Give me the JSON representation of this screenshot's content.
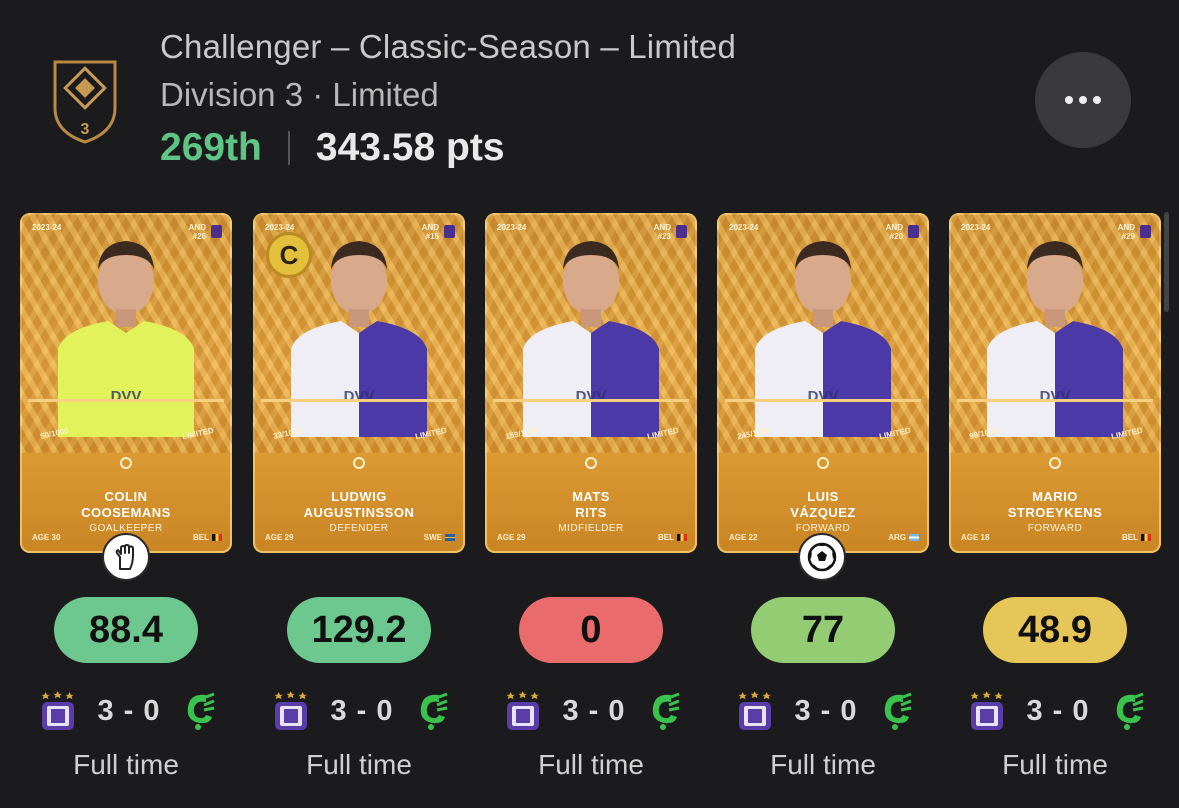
{
  "header": {
    "title": "Challenger – Classic-Season – Limited",
    "subtitle": "Division 3 · Limited",
    "rank": "269th",
    "points": "343.58 pts",
    "division_badge_number": "3",
    "more_icon": "more-horizontal-icon"
  },
  "colors": {
    "rank": "#5fc585",
    "score_green": "#6cc88f",
    "score_red": "#ea6b6b",
    "score_lightgreen": "#94cc74",
    "score_yellow": "#e6c559",
    "card_gold": "#e2a33d"
  },
  "players": [
    {
      "name_line1": "COLIN",
      "name_line2": "COOSEMANS",
      "position": "GOALKEEPER",
      "season": "2023-24",
      "club_code": "AND",
      "shirt": "#26",
      "serial": "50/1000",
      "rarity": "LIMITED",
      "age": "AGE 30",
      "nation": "BEL",
      "score": "88.4",
      "score_color": "#6cc88f",
      "match_result": "3 - 0",
      "match_status": "Full time",
      "stat_icon": "goalkeeper-glove-icon"
    },
    {
      "name_line1": "LUDWIG",
      "name_line2": "AUGUSTINSSON",
      "position": "DEFENDER",
      "season": "2023-24",
      "club_code": "AND",
      "shirt": "#15",
      "serial": "33/1000",
      "rarity": "LIMITED",
      "age": "AGE 29",
      "nation": "SWE",
      "score": "129.2",
      "score_color": "#6cc88f",
      "match_result": "3 - 0",
      "match_status": "Full time",
      "captain": "C"
    },
    {
      "name_line1": "MATS",
      "name_line2": "RITS",
      "position": "MIDFIELDER",
      "season": "2023-24",
      "club_code": "AND",
      "shirt": "#23",
      "serial": "159/1000",
      "rarity": "LIMITED",
      "age": "AGE 29",
      "nation": "BEL",
      "score": "0",
      "score_color": "#ea6b6b",
      "match_result": "3 - 0",
      "match_status": "Full time"
    },
    {
      "name_line1": "LUIS",
      "name_line2": "VÁZQUEZ",
      "position": "FORWARD",
      "season": "2023-24",
      "club_code": "AND",
      "shirt": "#20",
      "serial": "245/1000",
      "rarity": "LIMITED",
      "age": "AGE 22",
      "nation": "ARG",
      "score": "77",
      "score_color": "#94cc74",
      "match_result": "3 - 0",
      "match_status": "Full time",
      "stat_icon": "soccer-ball-icon"
    },
    {
      "name_line1": "MARIO",
      "name_line2": "STROEYKENS",
      "position": "FORWARD",
      "season": "2023-24",
      "club_code": "AND",
      "shirt": "#29",
      "serial": "99/1000",
      "rarity": "LIMITED",
      "age": "AGE 18",
      "nation": "BEL",
      "score": "48.9",
      "score_color": "#e6c559",
      "match_result": "3 - 0",
      "match_status": "Full time"
    }
  ]
}
